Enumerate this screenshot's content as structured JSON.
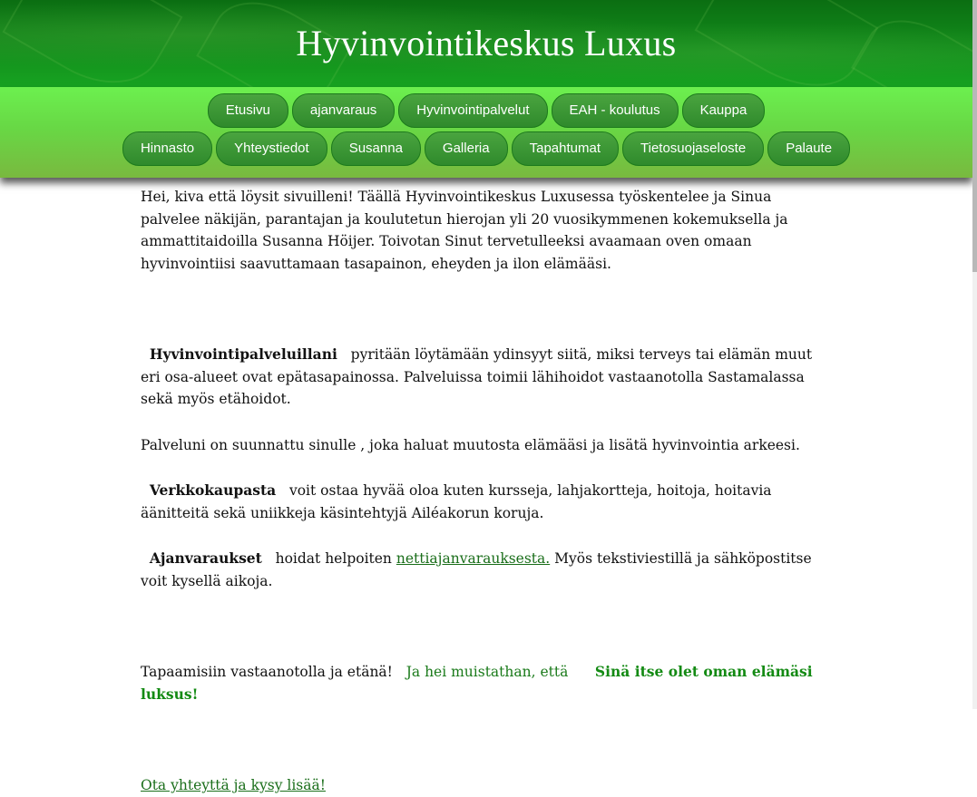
{
  "header": {
    "title": "Hyvinvointikeskus Luxus"
  },
  "nav": {
    "row1": [
      {
        "label": "Etusivu"
      },
      {
        "label": "ajanvaraus"
      },
      {
        "label": "Hyvinvointipalvelut"
      },
      {
        "label": "EAH - koulutus"
      },
      {
        "label": "Kauppa"
      }
    ],
    "row2": [
      {
        "label": "Hinnasto"
      },
      {
        "label": "Yhteystiedot"
      },
      {
        "label": "Susanna"
      },
      {
        "label": "Galleria"
      },
      {
        "label": "Tapahtumat"
      },
      {
        "label": "Tietosuojaseloste"
      },
      {
        "label": "Palaute"
      }
    ]
  },
  "content": {
    "intro": "Hei, kiva että löysit sivuilleni! Täällä Hyvinvointikeskus Luxusessa työskentelee ja Sinua palvelee näkijän, parantajan ja koulutetun hierojan yli 20 vuosikymmenen kokemuksella ja ammattitaidoilla Susanna Höijer. Toivotan Sinut tervetulleeksi avaamaan oven omaan hyvinvointiisi saavuttamaan tasapainon, eheyden ja ilon elämääsi.",
    "services_bold": "Hyvinvointipalveluillani",
    "services_text": "pyritään löytämään ydinsyyt siitä, miksi terveys tai elämän muut eri osa-alueet ovat epätasapainossa. Palveluissa toimii lähihoidot vastaanotolla Sastamalassa sekä myös etähoidot.",
    "designed_for_you": "Palveluni on suunnattu sinulle , joka haluat muutosta elämääsi ja lisätä hyvinvointia arkeesi.",
    "shop_bold": "Verkkokaupasta",
    "shop_text": "voit ostaa hyvää oloa kuten kursseja, lahjakortteja, hoitoja, hoitavia äänitteitä sekä uniikkeja käsintehtyjä Ailéakorun koruja.",
    "booking_bold": "Ajanvaraukset",
    "booking_text_before": "hoidat helpoiten",
    "booking_link": "nettiajanvarauksesta.",
    "booking_text_after": "Myös tekstiviestillä ja sähköpostitse voit kysellä aikoja.",
    "meet_text": "Tapaamisiin vastaanotolla ja etänä!",
    "remember_text": "Ja hei muistathan, että",
    "luxury_text": "Sinä itse olet oman elämäsi luksus!",
    "contact_link": "Ota yhteyttä ja kysy lisää!"
  },
  "colors": {
    "header_green": "#0b6e12",
    "nav_green": "#6cf04f",
    "button_green": "#2f8a2c",
    "link_green": "#1a6e1a"
  }
}
